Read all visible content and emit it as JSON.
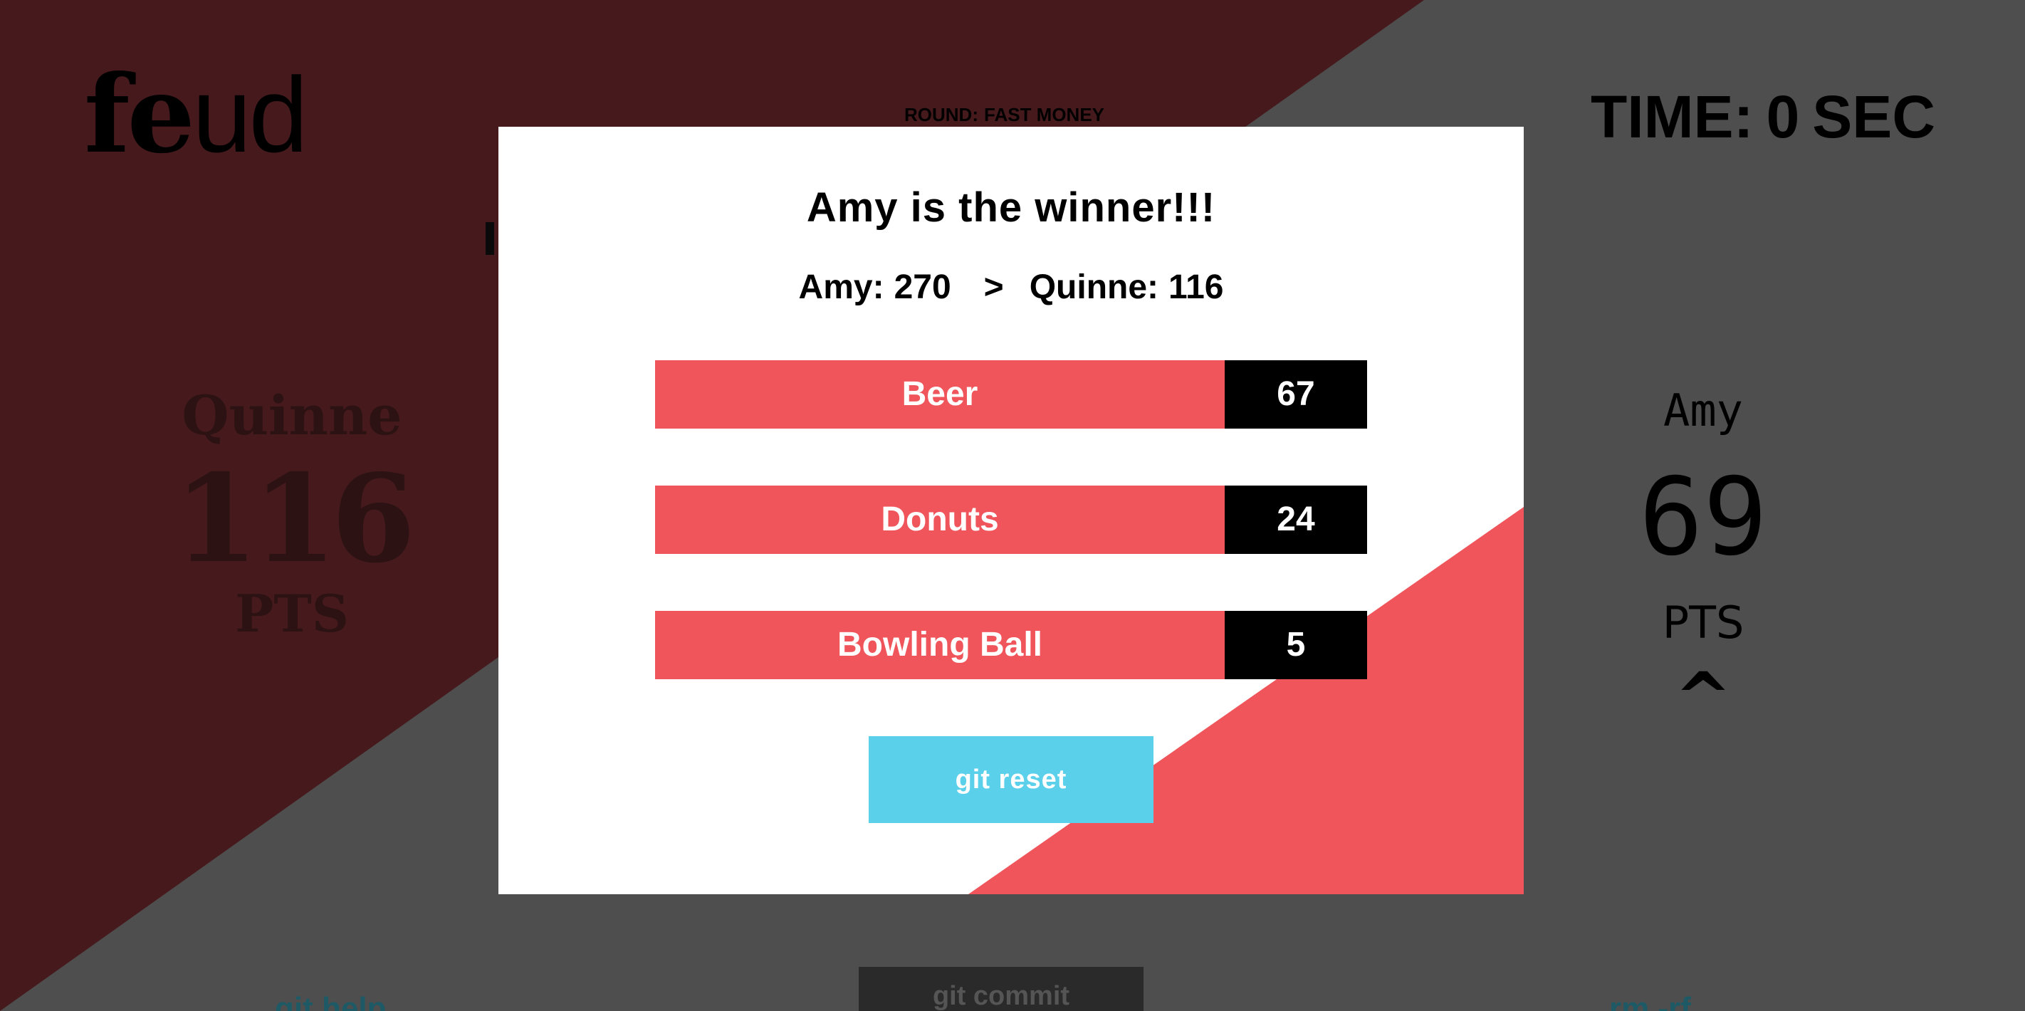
{
  "colors": {
    "background_gray": "#4e4e4e",
    "background_dark_red": "#461a1d",
    "accent_red": "#ef555a",
    "reset_blue": "#5bd0eb",
    "modal_white": "#ffffff"
  },
  "header": {
    "logo_heavy": "fe",
    "logo_light": "ud",
    "round_label": "ROUND:",
    "round_value": "FAST MONEY",
    "time_label": "TIME:",
    "time_value": "0",
    "time_unit": "SEC"
  },
  "players": {
    "left": {
      "name": "Quinne",
      "score": "116",
      "pts_label": "PTS"
    },
    "right": {
      "name": "Amy",
      "score": "69",
      "pts_label": "PTS",
      "indicator": "^"
    }
  },
  "footer": {
    "left_link": "git help",
    "center_button": "git commit",
    "right_link": "rm -rf"
  },
  "modal": {
    "title": "Amy is the winner!!!",
    "winner_name": "Amy:",
    "winner_score": "270",
    "comparator": ">",
    "loser_name": "Quinne:",
    "loser_score": "116",
    "answers": [
      {
        "label": "Beer",
        "points": "67"
      },
      {
        "label": "Donuts",
        "points": "24"
      },
      {
        "label": "Bowling Ball",
        "points": "5"
      }
    ],
    "reset_label": "git reset"
  }
}
